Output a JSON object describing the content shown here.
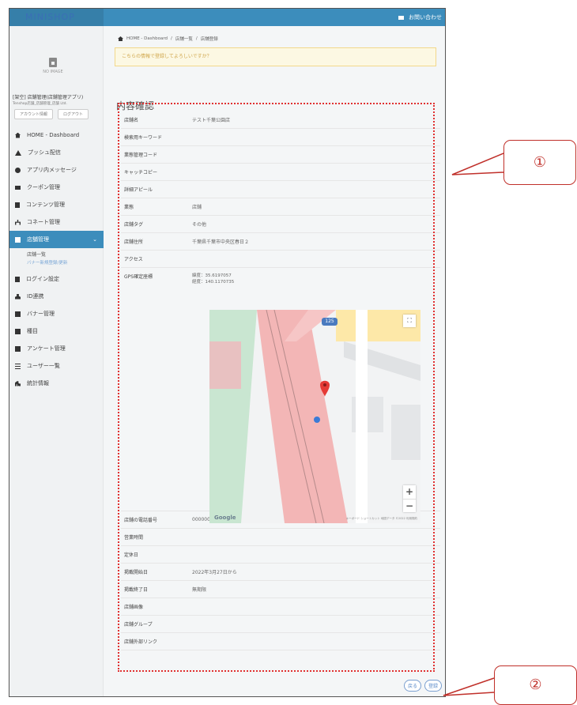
{
  "app": {
    "logo_text": "MINISHOP",
    "contact_label": "お問い合わせ"
  },
  "sidebar": {
    "nodata_label": "NO IMAGE",
    "shop_name": "[架空] 店舗管理(店舗管理アプリ)",
    "shop_sub": "Tenshop店舗_店舗管理_店舗 Ltd.",
    "account_label": "アカウント情報",
    "logout_label": "ログアウト",
    "items": [
      {
        "label": "HOME - Dashboard",
        "icon": "home-icon"
      },
      {
        "label": "プッシュ配信",
        "icon": "bell-icon"
      },
      {
        "label": "アプリ内メッセージ",
        "icon": "message-icon"
      },
      {
        "label": "クーポン管理",
        "icon": "coupon-icon"
      },
      {
        "label": "コンテンツ管理",
        "icon": "document-icon"
      },
      {
        "label": "コネート管理",
        "icon": "sitemap-icon"
      },
      {
        "label": "店舗管理",
        "icon": "store-icon",
        "active": true
      },
      {
        "label": "ログイン設定",
        "icon": "lock-icon"
      },
      {
        "label": "ID連携",
        "icon": "user-icon"
      },
      {
        "label": "バナー管理",
        "icon": "banner-icon"
      },
      {
        "label": "種目",
        "icon": "grid-icon"
      },
      {
        "label": "アンケート管理",
        "icon": "survey-icon"
      },
      {
        "label": "ユーザー一覧",
        "icon": "list-icon"
      },
      {
        "label": "統計情報",
        "icon": "chart-icon"
      }
    ],
    "submenu": [
      "店舗一覧",
      "バナー新規登録/更新"
    ]
  },
  "breadcrumb": [
    "HOME - Dashboard",
    "店舗一覧",
    "店舗登録"
  ],
  "alert_text": "こちらの情報で登録してよろしいですか？",
  "page_title": "内容確認",
  "fields": [
    {
      "label": "店舗名",
      "value": "テスト千葉公園店"
    },
    {
      "label": "検索用キーワード",
      "value": ""
    },
    {
      "label": "業態管理コード",
      "value": ""
    },
    {
      "label": "キャッチコピー",
      "value": ""
    },
    {
      "label": "詳細アピール",
      "value": ""
    },
    {
      "label": "業態",
      "value": "店舗"
    },
    {
      "label": "店舗タグ",
      "value": "その他"
    },
    {
      "label": "店舗住所",
      "value": "千葉県千葉市中央区春日２"
    },
    {
      "label": "アクセス",
      "value": ""
    }
  ],
  "gps": {
    "label": "GPS確定座標",
    "lat": "緯度：35.6197057",
    "lng": "経度：140.1170735"
  },
  "map": {
    "logo": "Google",
    "footer": "キーボード ショートカット  地図データ ©2022  利用規約",
    "route_badge": "125",
    "fullscreen": "⛶",
    "zoom_in": "+",
    "zoom_out": "−"
  },
  "fields_after": [
    {
      "label": "店舗の電話番号",
      "value": "0000000000"
    },
    {
      "label": "営業時間",
      "value": ""
    },
    {
      "label": "定休日",
      "value": ""
    },
    {
      "label": "掲載開始日",
      "value": "2022年3月27日から"
    },
    {
      "label": "掲載終了日",
      "value": "無期限"
    },
    {
      "label": "店舗画像",
      "value": ""
    },
    {
      "label": "店舗グループ",
      "value": ""
    },
    {
      "label": "店舗外部リンク",
      "value": ""
    }
  ],
  "buttons": {
    "back": "戻る",
    "submit": "登録"
  },
  "callouts": {
    "one": "①",
    "two": "②"
  },
  "colors": {
    "accent": "#3c8dbc",
    "annotation": "#c0302a"
  }
}
